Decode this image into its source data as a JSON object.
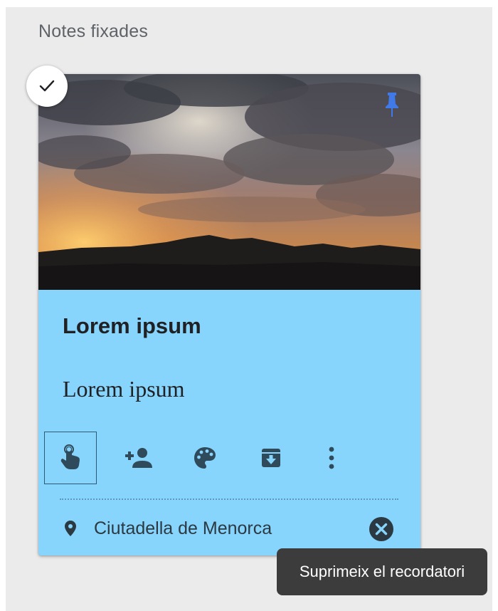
{
  "section": {
    "title": "Notes fixades"
  },
  "note": {
    "title": "Lorem ipsum",
    "body": "Lorem ipsum",
    "background_color": "#87d4fc",
    "pinned": true,
    "selected": true,
    "image": {
      "icon": "sunset-landscape-photo"
    },
    "toolbar": [
      {
        "icon": "remind-me-icon",
        "active": true
      },
      {
        "icon": "collaborator-icon",
        "active": false
      },
      {
        "icon": "palette-icon",
        "active": false
      },
      {
        "icon": "archive-icon",
        "active": false
      },
      {
        "icon": "more-vert-icon",
        "active": false
      }
    ],
    "location": {
      "label": "Ciutadella de Menorca",
      "icon": "location-pin-icon"
    }
  },
  "tooltip": {
    "text": "Suprimeix el recordatori"
  },
  "colors": {
    "page_background": "#ebebeb",
    "icon_color": "#2f4a5a",
    "tooltip_background": "#3c3c3c",
    "pin_color": "#3f7ae8"
  }
}
